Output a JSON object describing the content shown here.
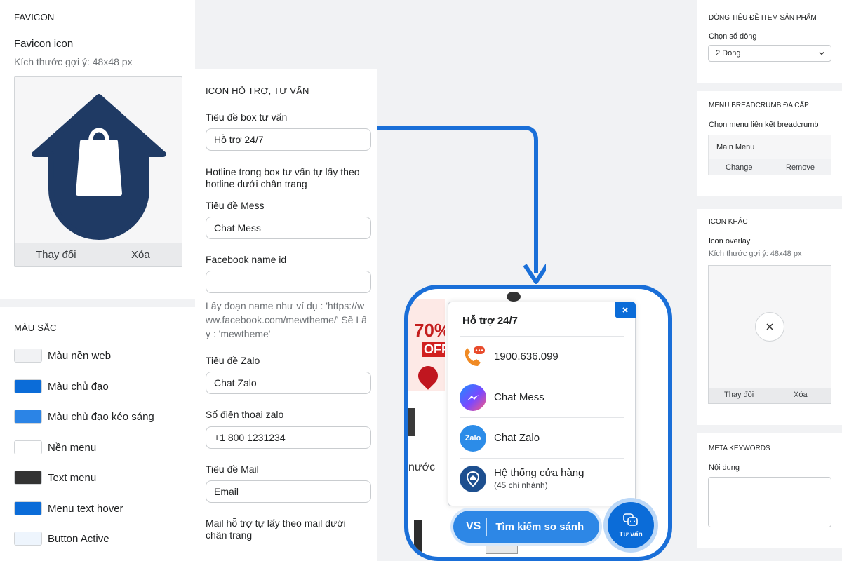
{
  "favicon": {
    "section_title": "FAVICON",
    "label": "Favicon icon",
    "hint": "Kích thước gợi ý: 48x48 px",
    "change_label": "Thay đổi",
    "delete_label": "Xóa",
    "icon": "house-shopping-bag-icon"
  },
  "colors": {
    "section_title": "MÀU SẮC",
    "items": [
      {
        "label": "Màu nền web",
        "color": "#f1f2f4"
      },
      {
        "label": "Màu chủ đạo",
        "color": "#0b6cd8"
      },
      {
        "label": "Màu chủ đạo kéo sáng",
        "color": "#2b84e6"
      },
      {
        "label": "Nền menu",
        "color": "#ffffff"
      },
      {
        "label": "Text menu",
        "color": "#333333"
      },
      {
        "label": "Menu text hover",
        "color": "#0b6cd8"
      },
      {
        "label": "Button Active",
        "color": "#eef5fd"
      }
    ]
  },
  "support": {
    "section_title": "ICON HỖ TRỢ, TƯ VẤN",
    "box_title_label": "Tiêu đề box tư vấn",
    "box_title_value": "Hỗ trợ 24/7",
    "hotline_note": "Hotline trong box tư vấn tự lấy theo hotline dưới chân trang",
    "mess_label": "Tiêu đề Mess",
    "mess_value": "Chat Mess",
    "fb_label": "Facebook name id",
    "fb_value": "",
    "fb_hint": "Lấy đoạn name như ví dụ : 'https://www.facebook.com/mewtheme/' Sẽ Lấy : 'mewtheme'",
    "zalo_label": "Tiêu đề Zalo",
    "zalo_value": "Chat Zalo",
    "zalo_phone_label": "Số điện thoại zalo",
    "zalo_phone_value": "+1 800 1231234",
    "mail_label": "Tiêu đề Mail",
    "mail_value": "Email",
    "mail_note": "Mail hỗ trợ tự lấy theo mail dưới chân trang"
  },
  "product_title": {
    "section_title": "DÒNG TIÊU ĐỀ ITEM SẢN PHẨM",
    "label": "Chọn số dòng",
    "select_value": "2 Dòng"
  },
  "breadcrumb": {
    "section_title": "MENU BREADCRUMB ĐA CẤP",
    "label": "Chọn menu liên kết breadcrumb",
    "menu_value": "Main Menu",
    "change_label": "Change",
    "remove_label": "Remove"
  },
  "other_icon": {
    "section_title": "ICON KHÁC",
    "label": "Icon overlay",
    "hint": "Kích thước gợi ý: 48x48 px",
    "change_label": "Thay đổi",
    "delete_label": "Xóa"
  },
  "meta": {
    "section_title": "META KEYWORDS",
    "label": "Nội dung"
  },
  "preview": {
    "popup_title": "Hỗ trợ 24/7",
    "items": [
      {
        "text": "1900.636.099",
        "sub": "",
        "icon": "phone-icon"
      },
      {
        "text": "Chat Mess",
        "sub": "",
        "icon": "messenger-icon"
      },
      {
        "text": "Chat Zalo",
        "sub": "",
        "icon": "zalo-icon"
      },
      {
        "text": "Hệ thống cửa hàng",
        "sub": "(45 chi nhánh)",
        "icon": "store-location-icon"
      }
    ],
    "zalo_icon_text": "Zalo",
    "compare_vs": "VS",
    "compare_label": "Tìm kiếm so sánh",
    "consult_label": "Tư vấn",
    "bg_promo_big": "70%",
    "bg_promo_small": "OFF",
    "bg_text": "nước"
  },
  "accent": "#1a6fd8"
}
